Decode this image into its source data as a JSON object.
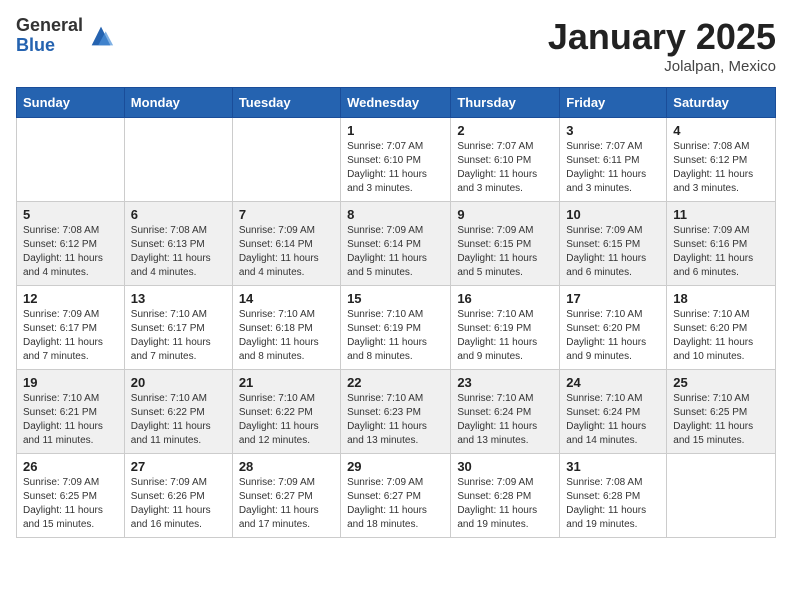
{
  "logo": {
    "general": "General",
    "blue": "Blue"
  },
  "header": {
    "month": "January 2025",
    "location": "Jolalpan, Mexico"
  },
  "weekdays": [
    "Sunday",
    "Monday",
    "Tuesday",
    "Wednesday",
    "Thursday",
    "Friday",
    "Saturday"
  ],
  "weeks": [
    [
      {
        "day": "",
        "info": ""
      },
      {
        "day": "",
        "info": ""
      },
      {
        "day": "",
        "info": ""
      },
      {
        "day": "1",
        "info": "Sunrise: 7:07 AM\nSunset: 6:10 PM\nDaylight: 11 hours and 3 minutes."
      },
      {
        "day": "2",
        "info": "Sunrise: 7:07 AM\nSunset: 6:10 PM\nDaylight: 11 hours and 3 minutes."
      },
      {
        "day": "3",
        "info": "Sunrise: 7:07 AM\nSunset: 6:11 PM\nDaylight: 11 hours and 3 minutes."
      },
      {
        "day": "4",
        "info": "Sunrise: 7:08 AM\nSunset: 6:12 PM\nDaylight: 11 hours and 3 minutes."
      }
    ],
    [
      {
        "day": "5",
        "info": "Sunrise: 7:08 AM\nSunset: 6:12 PM\nDaylight: 11 hours and 4 minutes."
      },
      {
        "day": "6",
        "info": "Sunrise: 7:08 AM\nSunset: 6:13 PM\nDaylight: 11 hours and 4 minutes."
      },
      {
        "day": "7",
        "info": "Sunrise: 7:09 AM\nSunset: 6:14 PM\nDaylight: 11 hours and 4 minutes."
      },
      {
        "day": "8",
        "info": "Sunrise: 7:09 AM\nSunset: 6:14 PM\nDaylight: 11 hours and 5 minutes."
      },
      {
        "day": "9",
        "info": "Sunrise: 7:09 AM\nSunset: 6:15 PM\nDaylight: 11 hours and 5 minutes."
      },
      {
        "day": "10",
        "info": "Sunrise: 7:09 AM\nSunset: 6:15 PM\nDaylight: 11 hours and 6 minutes."
      },
      {
        "day": "11",
        "info": "Sunrise: 7:09 AM\nSunset: 6:16 PM\nDaylight: 11 hours and 6 minutes."
      }
    ],
    [
      {
        "day": "12",
        "info": "Sunrise: 7:09 AM\nSunset: 6:17 PM\nDaylight: 11 hours and 7 minutes."
      },
      {
        "day": "13",
        "info": "Sunrise: 7:10 AM\nSunset: 6:17 PM\nDaylight: 11 hours and 7 minutes."
      },
      {
        "day": "14",
        "info": "Sunrise: 7:10 AM\nSunset: 6:18 PM\nDaylight: 11 hours and 8 minutes."
      },
      {
        "day": "15",
        "info": "Sunrise: 7:10 AM\nSunset: 6:19 PM\nDaylight: 11 hours and 8 minutes."
      },
      {
        "day": "16",
        "info": "Sunrise: 7:10 AM\nSunset: 6:19 PM\nDaylight: 11 hours and 9 minutes."
      },
      {
        "day": "17",
        "info": "Sunrise: 7:10 AM\nSunset: 6:20 PM\nDaylight: 11 hours and 9 minutes."
      },
      {
        "day": "18",
        "info": "Sunrise: 7:10 AM\nSunset: 6:20 PM\nDaylight: 11 hours and 10 minutes."
      }
    ],
    [
      {
        "day": "19",
        "info": "Sunrise: 7:10 AM\nSunset: 6:21 PM\nDaylight: 11 hours and 11 minutes."
      },
      {
        "day": "20",
        "info": "Sunrise: 7:10 AM\nSunset: 6:22 PM\nDaylight: 11 hours and 11 minutes."
      },
      {
        "day": "21",
        "info": "Sunrise: 7:10 AM\nSunset: 6:22 PM\nDaylight: 11 hours and 12 minutes."
      },
      {
        "day": "22",
        "info": "Sunrise: 7:10 AM\nSunset: 6:23 PM\nDaylight: 11 hours and 13 minutes."
      },
      {
        "day": "23",
        "info": "Sunrise: 7:10 AM\nSunset: 6:24 PM\nDaylight: 11 hours and 13 minutes."
      },
      {
        "day": "24",
        "info": "Sunrise: 7:10 AM\nSunset: 6:24 PM\nDaylight: 11 hours and 14 minutes."
      },
      {
        "day": "25",
        "info": "Sunrise: 7:10 AM\nSunset: 6:25 PM\nDaylight: 11 hours and 15 minutes."
      }
    ],
    [
      {
        "day": "26",
        "info": "Sunrise: 7:09 AM\nSunset: 6:25 PM\nDaylight: 11 hours and 15 minutes."
      },
      {
        "day": "27",
        "info": "Sunrise: 7:09 AM\nSunset: 6:26 PM\nDaylight: 11 hours and 16 minutes."
      },
      {
        "day": "28",
        "info": "Sunrise: 7:09 AM\nSunset: 6:27 PM\nDaylight: 11 hours and 17 minutes."
      },
      {
        "day": "29",
        "info": "Sunrise: 7:09 AM\nSunset: 6:27 PM\nDaylight: 11 hours and 18 minutes."
      },
      {
        "day": "30",
        "info": "Sunrise: 7:09 AM\nSunset: 6:28 PM\nDaylight: 11 hours and 19 minutes."
      },
      {
        "day": "31",
        "info": "Sunrise: 7:08 AM\nSunset: 6:28 PM\nDaylight: 11 hours and 19 minutes."
      },
      {
        "day": "",
        "info": ""
      }
    ]
  ]
}
